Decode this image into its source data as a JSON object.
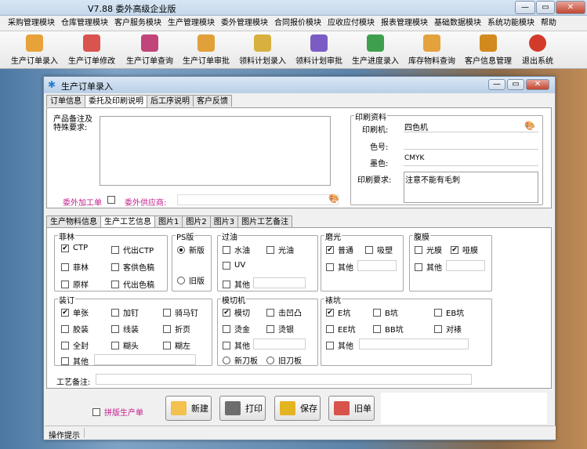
{
  "app": {
    "title_prefix": "",
    "title": "V7.88  委外高级企业版",
    "win_controls": [
      "—",
      "▭",
      "✕"
    ]
  },
  "menu": [
    "采购管理模块",
    "仓库管理模块",
    "客户服务模块",
    "生产管理模块",
    "委外管理模块",
    "合同报价模块",
    "应收应付模块",
    "报表管理模块",
    "基础数据模块",
    "系统功能模块",
    "帮助"
  ],
  "toolbar": [
    {
      "label": "生产订单录入",
      "color": "#e8a23a"
    },
    {
      "label": "生产订单修改",
      "color": "#d9534f"
    },
    {
      "label": "生产订单查询",
      "color": "#c1447a"
    },
    {
      "label": "生产订单审批",
      "color": "#e0a03a"
    },
    {
      "label": "领料计划录入",
      "color": "#d8b040"
    },
    {
      "label": "领料计划审批",
      "color": "#7b5cc4"
    },
    {
      "label": "生产进度录入",
      "color": "#3f9f4f"
    },
    {
      "label": "库存物料查询",
      "color": "#e4a23c"
    },
    {
      "label": "客户信息管理",
      "color": "#d28a1e"
    },
    {
      "label": "退出系统",
      "color": "#d23b2c"
    }
  ],
  "dialog": {
    "title": "生产订单录入",
    "tabs_top": [
      "订单信息",
      "委托及印刷说明",
      "后工序说明",
      "客户反馈"
    ],
    "product_note_label": "产品备注及\n特殊要求:",
    "outsource_label": "委外加工单",
    "supplier_label": "委外供应商:",
    "print_info": {
      "title": "印刷资料",
      "press_label": "印刷机:",
      "press_value": "四色机",
      "colorno_label": "色号:",
      "colorno_value": "",
      "ink_label": "墨色:",
      "ink_value": "CMYK",
      "req_label": "印刷要求:",
      "req_value": "注意不能有毛刺"
    },
    "tabs_mid": [
      "生产物料信息",
      "生产工艺信息",
      "图片1",
      "图片2",
      "图片3",
      "图片工艺备注"
    ],
    "feilin": {
      "title": "菲林",
      "items": [
        {
          "label": "CTP",
          "checked": true
        },
        {
          "label": "代出CTP",
          "checked": false
        },
        {
          "label": "菲林",
          "checked": false
        },
        {
          "label": "客供色稿",
          "checked": false
        },
        {
          "label": "原样",
          "checked": false
        },
        {
          "label": "代出色稿",
          "checked": false
        }
      ]
    },
    "psban": {
      "title": "PS版",
      "items": [
        {
          "label": "新版",
          "checked": true
        },
        {
          "label": "旧版",
          "checked": false
        }
      ]
    },
    "guoyou": {
      "title": "过油",
      "items": [
        {
          "label": "水油",
          "checked": false
        },
        {
          "label": "光油",
          "checked": false
        },
        {
          "label": "UV",
          "checked": false
        },
        {
          "label": "其他",
          "checked": false
        }
      ]
    },
    "moguang": {
      "title": "磨光",
      "items": [
        {
          "label": "普通",
          "checked": true
        },
        {
          "label": "吸塑",
          "checked": false
        },
        {
          "label": "其他",
          "checked": false
        }
      ]
    },
    "fumo": {
      "title": "腹膜",
      "items": [
        {
          "label": "光膜",
          "checked": false
        },
        {
          "label": "哑膜",
          "checked": true
        },
        {
          "label": "其他",
          "checked": false
        }
      ]
    },
    "zhuangding": {
      "title": "装订",
      "items": [
        {
          "label": "单张",
          "checked": true
        },
        {
          "label": "加钉",
          "checked": false
        },
        {
          "label": "骑马钉",
          "checked": false
        },
        {
          "label": "胶装",
          "checked": false
        },
        {
          "label": "线装",
          "checked": false
        },
        {
          "label": "折页",
          "checked": false
        },
        {
          "label": "全封",
          "checked": false
        },
        {
          "label": "糊头",
          "checked": false
        },
        {
          "label": "糊左",
          "checked": false
        },
        {
          "label": "其他",
          "checked": false
        }
      ]
    },
    "moqie": {
      "title": "模切机",
      "items": [
        {
          "label": "模切",
          "checked": true
        },
        {
          "label": "击凹凸",
          "checked": false
        },
        {
          "label": "烫金",
          "checked": false
        },
        {
          "label": "烫银",
          "checked": false
        },
        {
          "label": "其他",
          "checked": false
        }
      ],
      "radios": [
        {
          "label": "新刀板",
          "checked": false
        },
        {
          "label": "旧刀板",
          "checked": false
        }
      ]
    },
    "biaokang": {
      "title": "裱坑",
      "items": [
        {
          "label": "E坑",
          "checked": true
        },
        {
          "label": "B坑",
          "checked": false
        },
        {
          "label": "EB坑",
          "checked": false
        },
        {
          "label": "EE坑",
          "checked": false
        },
        {
          "label": "BB坑",
          "checked": false
        },
        {
          "label": "对裱",
          "checked": false
        },
        {
          "label": "其他",
          "checked": false
        }
      ]
    },
    "craft_note_label": "工艺备注:",
    "pinban_label": "拼版生产单",
    "buttons": [
      "新建",
      "打印",
      "保存",
      "旧单"
    ],
    "status": "操作提示"
  }
}
